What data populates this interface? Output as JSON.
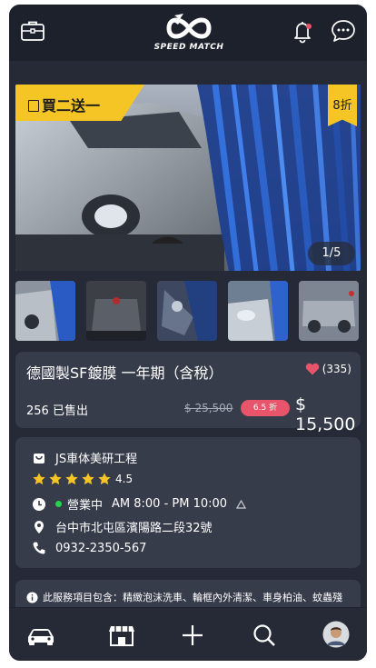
{
  "header": {
    "logo_text": "SPEED MATCH",
    "icons": [
      "briefcase-icon",
      "bell-icon",
      "chat-icon"
    ],
    "notification_dot_color": "#e8546a"
  },
  "hero": {
    "promo_label": "買二送一",
    "discount_label": "8折",
    "counter": "1/5",
    "accent_color": "#f5c525"
  },
  "product": {
    "title": "德國製SF鍍膜 一年期（含稅）",
    "likes": "(335)",
    "sold": "256 已售出",
    "original_price": "$ 25,500",
    "discount": "6.5 折",
    "price": "$ 15,500"
  },
  "shop": {
    "name": "JS車体美研工程",
    "rating": "4.5",
    "rating_stars": 5,
    "status": "營業中",
    "hours": "AM 8:00 - PM 10:00",
    "address": "台中市北屯區濱陽路二段32號",
    "phone": "0932-2350-567",
    "status_color": "#23d34a"
  },
  "notice": {
    "text": "此服務項目包含：精緻泡沫洗車、輪框內外清潔、車身柏油、蚊蟲殘膠、玻璃油膜、鐵粉去除、全車鍍膜施工、全車玻璃油膜去除、全車"
  },
  "tabbar": {
    "tabs": [
      "car-icon",
      "store-icon",
      "plus-icon",
      "search-icon",
      "avatar"
    ]
  }
}
